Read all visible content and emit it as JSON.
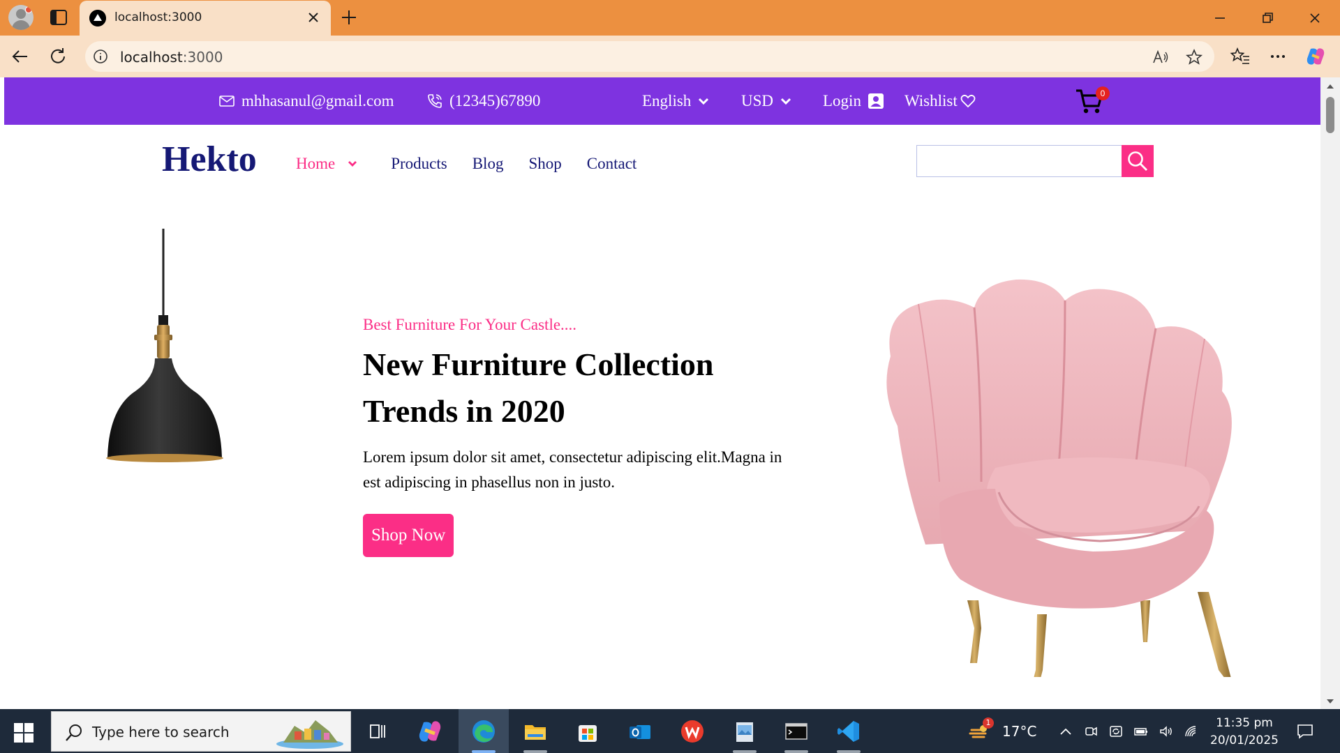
{
  "browser": {
    "tab_title": "localhost:3000",
    "url_host": "localhost",
    "url_port": ":3000"
  },
  "topbar": {
    "email": "mhhasanul@gmail.com",
    "phone": "(12345)67890",
    "language": "English",
    "currency": "USD",
    "login": "Login",
    "wishlist": "Wishlist",
    "cart_count": "0"
  },
  "nav": {
    "logo": "Hekto",
    "items": [
      {
        "label": "Home",
        "active": true
      },
      {
        "label": "Products"
      },
      {
        "label": "Blog"
      },
      {
        "label": "Shop"
      },
      {
        "label": "Contact"
      }
    ],
    "search_value": ""
  },
  "hero": {
    "subtitle": "Best Furniture For Your Castle....",
    "headline": "New Furniture Collection Trends in 2020",
    "description": "Lorem ipsum dolor sit amet, consectetur adipiscing elit.Magna in est adipiscing in phasellus non in justo.",
    "cta": "Shop Now"
  },
  "colors": {
    "topbar": "#7e33e0",
    "navy": "#151875",
    "pink": "#fb2e86",
    "browser_accent": "#ec9040"
  },
  "taskbar": {
    "search_placeholder": "Type here to search",
    "weather_badge": "1",
    "temperature": "17°C",
    "time": "11:35 pm",
    "date": "20/01/2025",
    "apps": [
      "task-view-icon",
      "copilot-icon",
      "edge-icon",
      "file-explorer-icon",
      "microsoft-store-icon",
      "outlook-icon",
      "wps-office-icon",
      "image-viewer-icon",
      "terminal-icon",
      "vscode-icon"
    ]
  }
}
